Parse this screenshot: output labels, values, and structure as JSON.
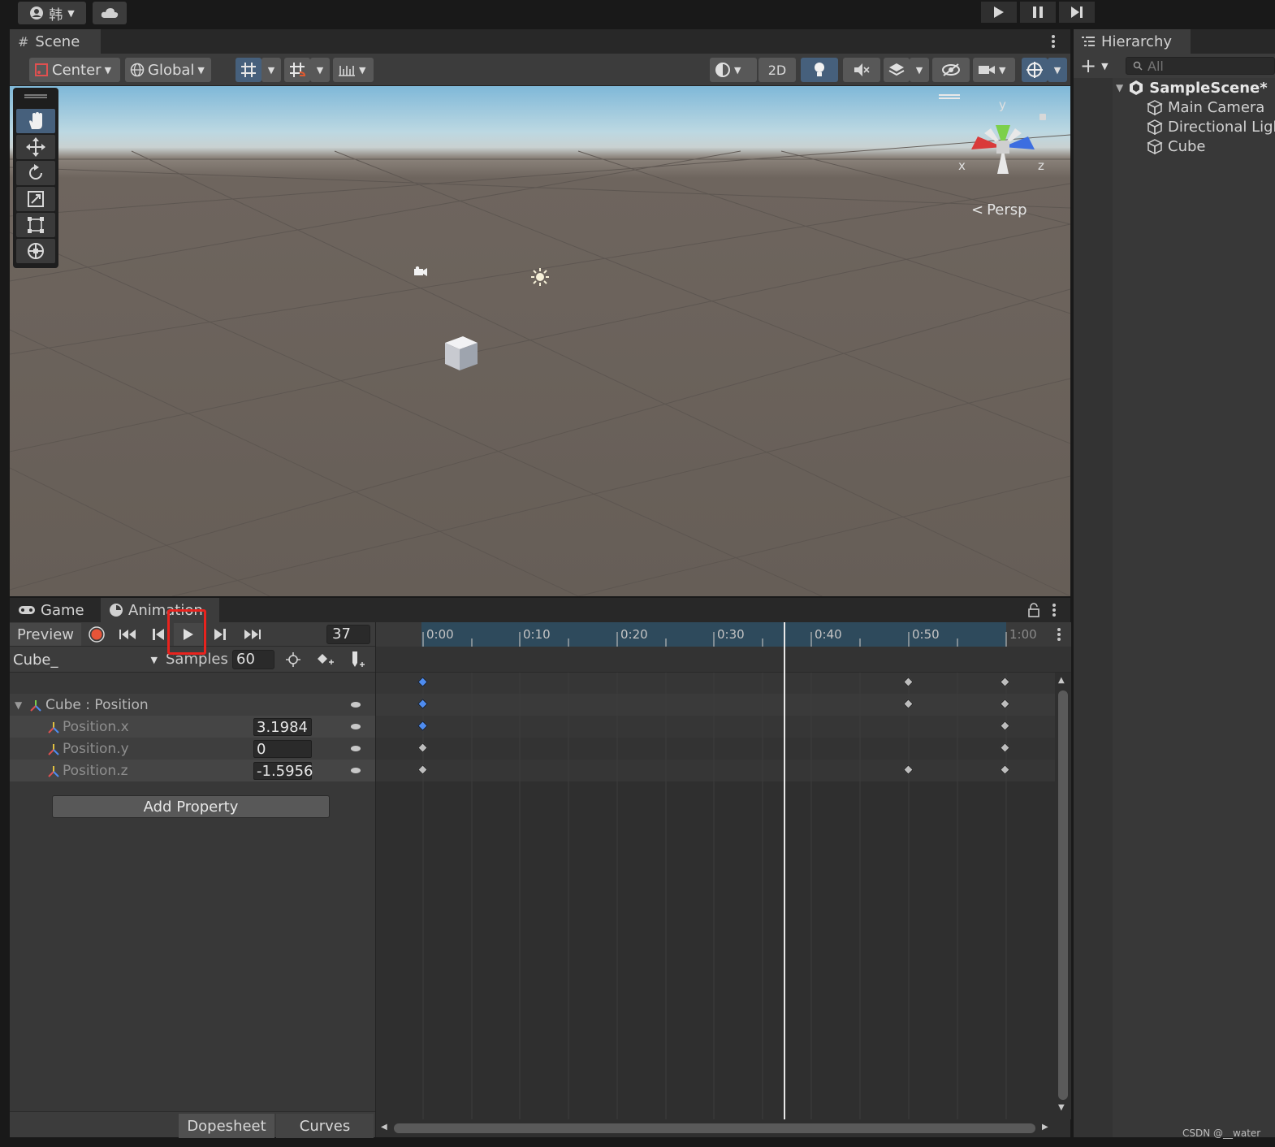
{
  "topbar": {
    "account_label": "韩",
    "play": "play-icon",
    "pause": "pause-icon",
    "step": "step-icon"
  },
  "scene": {
    "tab_label": "Scene",
    "toolbar": {
      "pivot_label": "Center",
      "space_label": "Global",
      "mode_2d": "2D"
    },
    "persp_label": "Persp",
    "gizmo": {
      "x": "x",
      "y": "y",
      "z": "z"
    }
  },
  "hierarchy": {
    "tab_label": "Hierarchy",
    "search_placeholder": "All",
    "scene_name": "SampleScene*",
    "items": [
      "Main Camera",
      "Directional Ligh",
      "Cube"
    ]
  },
  "animation": {
    "tabs": [
      "Game",
      "Animation"
    ],
    "preview_label": "Preview",
    "frame_value": "37",
    "clip_name": "Cube_",
    "samples_label": "Samples",
    "samples_value": "60",
    "group_label": "Cube : Position",
    "properties": [
      {
        "name": "Position.x",
        "value": "3.1984"
      },
      {
        "name": "Position.y",
        "value": "0"
      },
      {
        "name": "Position.z",
        "value": "-1.5956"
      }
    ],
    "add_property_label": "Add Property",
    "bottom_tabs": [
      "Dopesheet",
      "Curves"
    ],
    "ruler_labels": [
      "0:00",
      "0:10",
      "0:20",
      "0:30",
      "0:40",
      "0:50",
      "1:00"
    ]
  },
  "watermark": "CSDN @__water"
}
